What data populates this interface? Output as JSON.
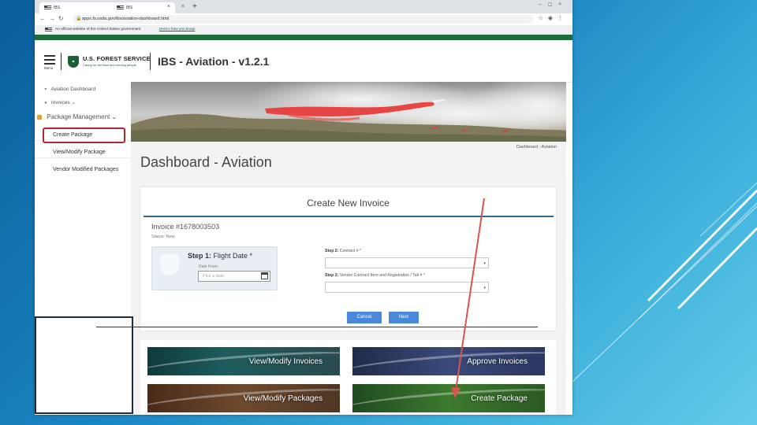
{
  "browser": {
    "tabs": [
      {
        "label": "IBS"
      },
      {
        "label": "IBS"
      }
    ],
    "url": "apps.fs.usda.gov/ibs/aviation-dashboard.html"
  },
  "gov_banner": {
    "text": "An official website of the United States government",
    "link": "Here's how you know"
  },
  "header": {
    "menu_label": "Menu",
    "agency_name": "U.S. FOREST SERVICE",
    "agency_tagline": "Caring for the land and serving people",
    "app_title": "IBS - Aviation - v1.2.1"
  },
  "sidebar": {
    "items": [
      {
        "label": "Aviation Dashboard"
      },
      {
        "label": "Invoices"
      },
      {
        "label": "Package Management"
      },
      {
        "label": "Create Package"
      },
      {
        "label": "View/Modify Package"
      },
      {
        "label": "Vendor Modified Packages"
      }
    ]
  },
  "breadcrumb": "Dashboard - Aviation",
  "page_title": "Dashboard - Aviation",
  "card": {
    "title": "Create New Invoice",
    "invoice_number": "Invoice #1678003503",
    "status": "Status: New",
    "step1_prefix": "Step 1:",
    "step1_label": "Flight Date *",
    "date_from_label": "Date From:",
    "date_placeholder": "Pick a date",
    "step2_prefix": "Step 2:",
    "step2_label": "Contract # *",
    "step3_prefix": "Step 3:",
    "step3_label": "Vendor Contract Item and Registration / Tail # *",
    "cancel_label": "Cancel",
    "next_label": "Next"
  },
  "tiles": [
    {
      "label": "View/Modify Invoices"
    },
    {
      "label": "Approve Invoices"
    },
    {
      "label": "View/Modify Packages"
    },
    {
      "label": "Create Package"
    }
  ]
}
